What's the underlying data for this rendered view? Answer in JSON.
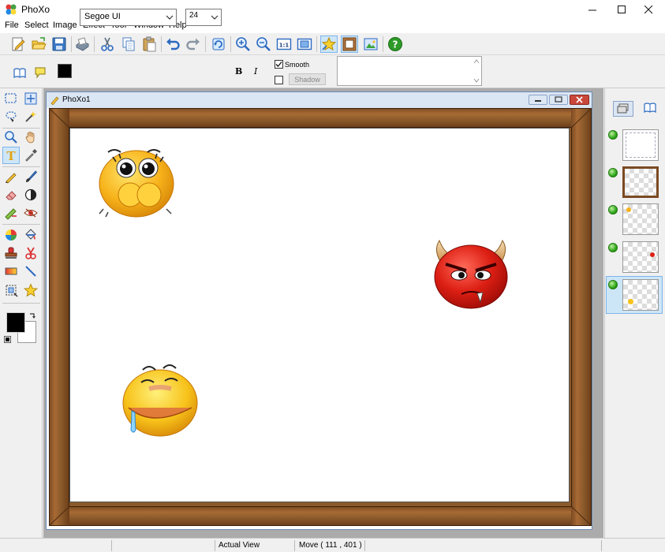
{
  "window": {
    "title": "PhoXo",
    "minimize_icon": "minimize-icon",
    "maximize_icon": "maximize-icon",
    "close_icon": "close-icon"
  },
  "menu": [
    "File",
    "Select",
    "Image",
    "Effect",
    "Tool",
    "Window",
    "Help"
  ],
  "toolbar": {
    "icons": [
      "new-icon",
      "open-icon",
      "save-icon",
      "scan-icon",
      "cut-icon",
      "copy-icon",
      "paste-icon",
      "undo-icon",
      "redo-icon",
      "refresh-icon",
      "zoom-in-icon",
      "zoom-out-icon",
      "actual-size-icon",
      "fit-window-icon",
      "star-effect-icon",
      "frame-icon",
      "export-icon",
      "help-icon"
    ]
  },
  "text_options": {
    "font": "Segoe UI",
    "size": "24",
    "bold_label": "B",
    "italic_label": "I",
    "smooth_label": "Smooth",
    "smooth_checked": true,
    "shadow_label": "Shadow",
    "shadow_checked": false,
    "text_color": "#000000"
  },
  "document": {
    "title": "PhoXo1"
  },
  "layers": {
    "count": 5
  },
  "status": {
    "view": "Actual View",
    "position": "Move ( 111 , 401 )"
  },
  "colors": {
    "foreground": "#000000",
    "background": "#ffffff",
    "frame_wood": "#8b5a2b"
  }
}
